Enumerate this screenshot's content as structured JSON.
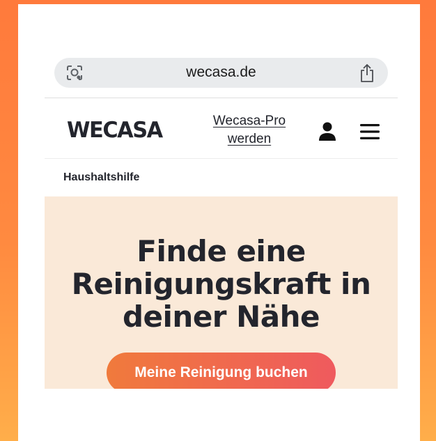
{
  "browser": {
    "domain": "wecasa.de",
    "icons": [
      "lens-icon",
      "share-icon"
    ]
  },
  "header": {
    "logo": "WECASA",
    "pro_link": "Wecasa-Pro werden",
    "icons": [
      "user-icon",
      "menu-icon"
    ]
  },
  "breadcrumb": "Haushaltshilfe",
  "hero": {
    "title": "Finde eine Reinigungskraft in deiner Nähe",
    "cta_label": "Meine Reinigung buchen"
  },
  "colors": {
    "background_gradient_top": "#ff7a3c",
    "background_gradient_bottom": "#ffae4a",
    "hero_bg": "#fae9d8",
    "cta_gradient_start": "#f07a3c",
    "cta_gradient_end": "#ef5a5e",
    "text_dark": "#23252d"
  }
}
